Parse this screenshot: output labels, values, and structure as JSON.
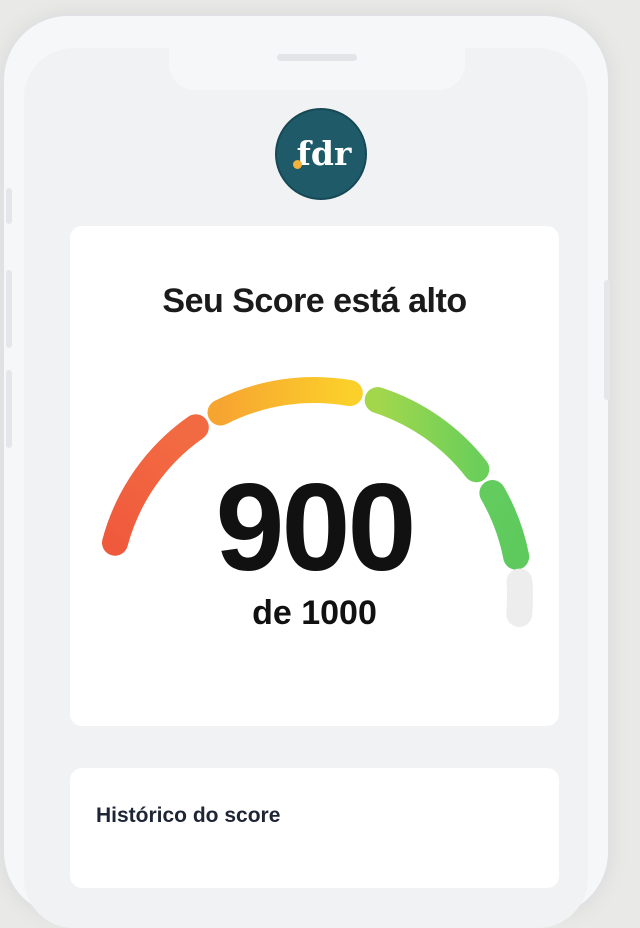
{
  "logo": {
    "text": "fdr",
    "dot_color": "#f4b23a",
    "background_color": "#1f5a68"
  },
  "score_card": {
    "title": "Seu Score está alto",
    "score": "900",
    "max_label": "de 1000",
    "score_value": 900,
    "score_max": 1000,
    "gauge_segments": [
      {
        "name": "very-low",
        "color_start": "#f05a3c",
        "color_end": "#f4693f"
      },
      {
        "name": "low",
        "color_start": "#f7a531",
        "color_end": "#fbcf2a"
      },
      {
        "name": "medium",
        "color_start": "#a7d84c",
        "color_end": "#7bd45a"
      },
      {
        "name": "high",
        "color_start": "#5dc95e",
        "color_end": "#63cf63"
      },
      {
        "name": "very-high",
        "color_start": "#ececec",
        "color_end": "#ececec"
      }
    ]
  },
  "history_card": {
    "title": "Histórico do score"
  }
}
